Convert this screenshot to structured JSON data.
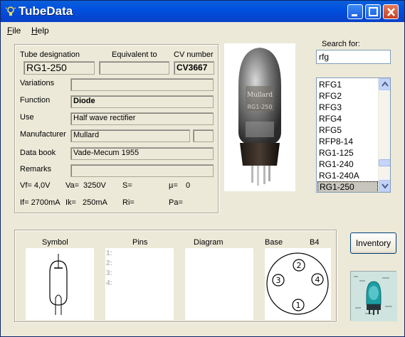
{
  "window": {
    "title": "TubeData"
  },
  "menu": {
    "file": "F",
    "file_rest": "ile",
    "help": "H",
    "help_rest": "elp"
  },
  "search": {
    "label": "Search for:",
    "value": "rfg"
  },
  "tube_list": {
    "items": [
      "RFG1",
      "RFG2",
      "RFG3",
      "RFG4",
      "RFG5",
      "RFP8-14",
      "RG1-125",
      "RG1-240",
      "RG1-240A",
      "RG1-250"
    ],
    "selected": "RG1-250"
  },
  "details": {
    "tube_designation_label": "Tube designation",
    "tube_designation": "RG1-250",
    "equivalent_label": "Equivalent to",
    "equivalent": "",
    "cv_label": "CV number",
    "cv": "CV3667",
    "variations_label": "Variations",
    "variations": "",
    "function_label": "Function",
    "function": "Diode",
    "use_label": "Use",
    "use": "Half wave rectifier",
    "manufacturer_label": "Manufacturer",
    "manufacturer": "Mullard",
    "manufacturer_code": "",
    "databook_label": "Data book",
    "databook": "Vade-Mecum 1955",
    "remarks_label": "Remarks",
    "remarks": ""
  },
  "params": {
    "vf": "Vf= 4,0V",
    "va": "Va=",
    "va_value": "3250V",
    "s": "S=",
    "mu": "µ=",
    "mu_value": "0",
    "if": "If= 2700mA",
    "ik": "Ik=",
    "ik_value": "250mA",
    "ri": "Ri=",
    "pa": "Pa="
  },
  "bottom": {
    "symbol_label": "Symbol",
    "pins_label": "Pins",
    "diagram_label": "Diagram",
    "base_label": "Base",
    "base_type": "B4",
    "pins": [
      "1:",
      "2:",
      "3:",
      "4:"
    ],
    "base_pins": [
      "1",
      "2",
      "3",
      "4"
    ]
  },
  "inventory_button": "Inventory",
  "photo": {
    "logo": "Mullard",
    "marking": "RG1-250"
  },
  "colors": {
    "titlebar": "#0050e0",
    "face": "#ece9d8",
    "selection": "#c7c5bc"
  }
}
